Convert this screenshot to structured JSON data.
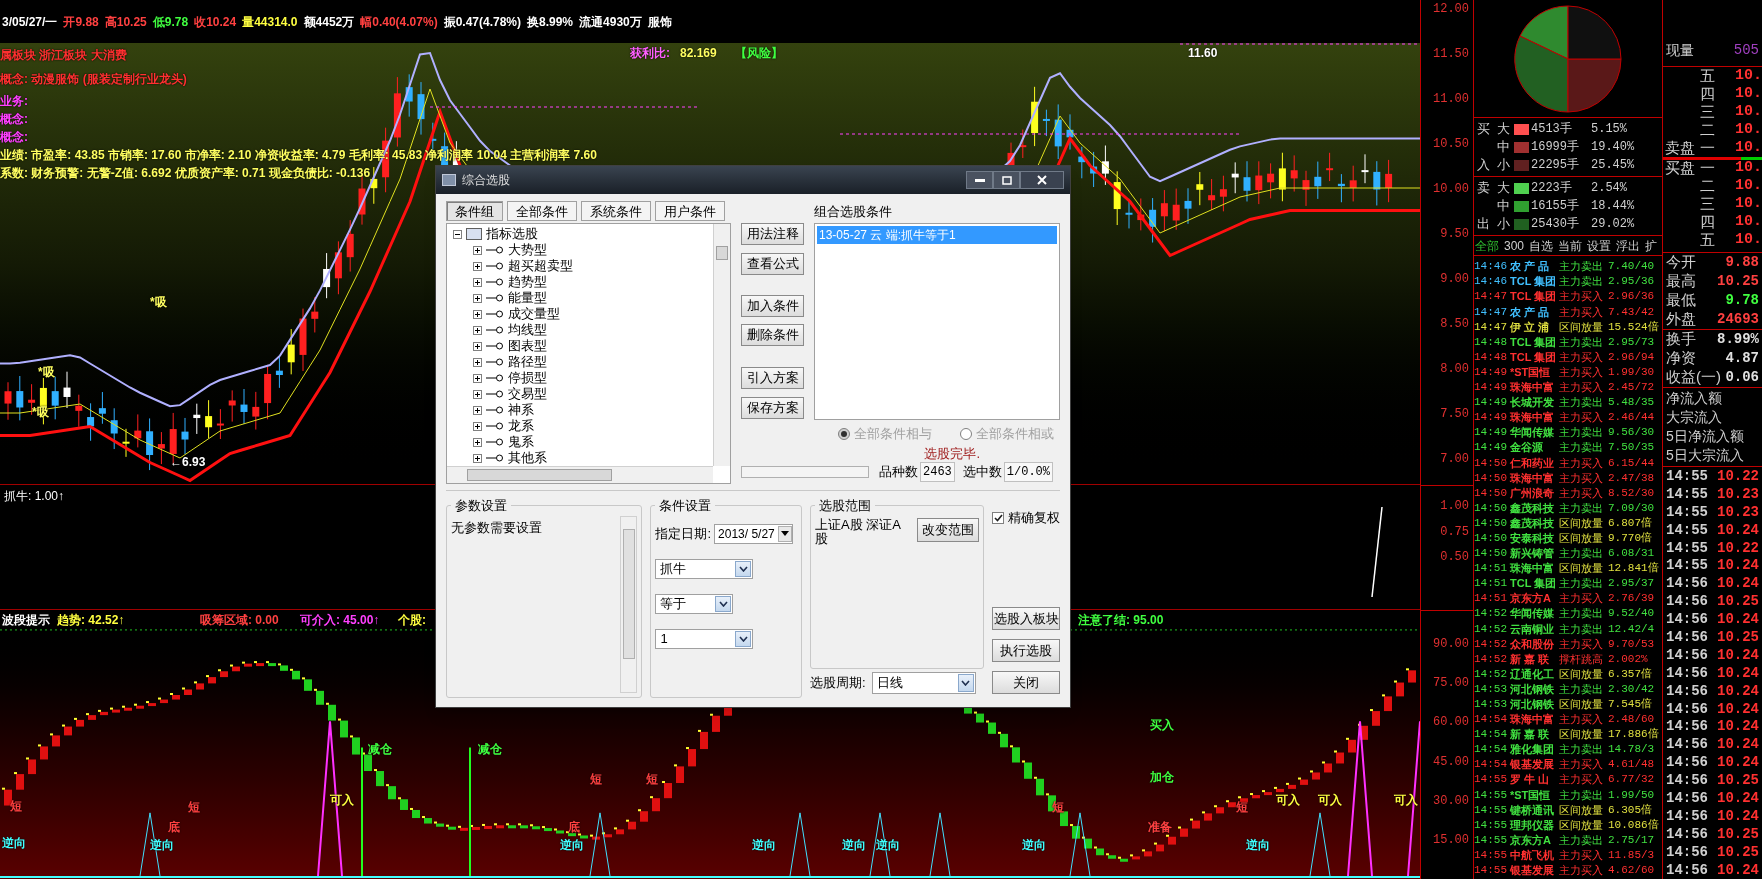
{
  "quote_bar": [
    {
      "text": "3/05/27/一",
      "color": "#ffffff"
    },
    {
      "text": "开9.88",
      "color": "#ff4040"
    },
    {
      "text": "高10.25",
      "color": "#ff4040"
    },
    {
      "text": "低9.78",
      "color": "#40ff40"
    },
    {
      "text": "收10.24",
      "color": "#ff4040"
    },
    {
      "text": "量44314.0",
      "color": "#ffff40"
    },
    {
      "text": "额4452万",
      "color": "#ffffff"
    },
    {
      "text": "幅0.40(4.07%)",
      "color": "#ff4040"
    },
    {
      "text": "振0.47(4.78%)",
      "color": "#ffffff"
    },
    {
      "text": "换8.99%",
      "color": "#ffffff"
    },
    {
      "text": "流通4930万",
      "color": "#ffffff"
    },
    {
      "text": "服饰",
      "color": "#ffffff"
    }
  ],
  "price_chart": {
    "info_lines": [
      {
        "text": "属板块 浙江板块 大消费",
        "color": "#ff3030"
      },
      {
        "text": "概念: 动漫服饰 (服装定制行业龙头)",
        "color": "#ff3030"
      },
      {
        "text": "业务:",
        "color": "#ff40ff"
      },
      {
        "text": "概念:",
        "color": "#ff40ff"
      },
      {
        "text": "概念:",
        "color": "#ff40ff"
      },
      {
        "text": "业绩: 市盈率: 43.85 市销率: 17.60 市净率: 2.10 净资收益率: 4.79 毛利率: 45.83 净利润率 10.04 主营利润率 7.60",
        "color": "#ffff60"
      },
      {
        "text": "系数: 财务预警: 无警-Z值: 6.692 优质资产率: 0.71 现金负债比: -0.136",
        "color": "#ffff60"
      }
    ],
    "labels": [
      {
        "text": "获利比:",
        "color": "#ff60ff"
      },
      {
        "text": "82.169",
        "color": "#ffff60"
      },
      {
        "text": "【风险】",
        "color": "#40ff40"
      },
      {
        "text": "11.60",
        "color": "#ffffff"
      },
      {
        "text": "←6.93",
        "color": "#ffffff"
      },
      {
        "text": "*吸",
        "color": "#ffff60"
      },
      {
        "text": "*吸",
        "color": "#ffff60"
      },
      {
        "text": "*吸",
        "color": "#ffff60"
      }
    ],
    "axis_ticks": [
      "12.00",
      "11.50",
      "11.00",
      "10.50",
      "10.00",
      "9.50",
      "9.00",
      "8.50",
      "8.00",
      "7.50",
      "7.00"
    ]
  },
  "indicator_1": {
    "title": "抓牛: 1.00↑",
    "axis_ticks": [
      "1.00",
      "0.75",
      "0.50"
    ]
  },
  "indicator_2": {
    "header": [
      {
        "text": "波段提示",
        "color": "#ffffff"
      },
      {
        "text": "趋势: 42.52↑",
        "color": "#ffff40"
      },
      {
        "text": "吸筹区域: 0.00",
        "color": "#ff4040"
      },
      {
        "text": "可介入: 45.00↑",
        "color": "#ff40ff"
      },
      {
        "text": "个股:",
        "color": "#ffff40"
      },
      {
        "text": "注意了结: 95.00",
        "color": "#40ff40"
      }
    ],
    "annotations": [
      {
        "text": "短",
        "color": "#ff4040"
      },
      {
        "text": "逆向",
        "color": "#40ffff"
      },
      {
        "text": "底",
        "color": "#ff4040"
      },
      {
        "text": "逆向",
        "color": "#40ffff"
      },
      {
        "text": "短",
        "color": "#ff4040"
      },
      {
        "text": "可入",
        "color": "#ffff40"
      },
      {
        "text": "减仓",
        "color": "#40ff40"
      },
      {
        "text": "减仓",
        "color": "#40ff40"
      },
      {
        "text": "底",
        "color": "#ff4040"
      },
      {
        "text": "短",
        "color": "#ff4040"
      },
      {
        "text": "逆向",
        "color": "#40ffff"
      },
      {
        "text": "短",
        "color": "#ff4040"
      },
      {
        "text": "逆向",
        "color": "#40ffff"
      },
      {
        "text": "逆向",
        "color": "#40ffff"
      },
      {
        "text": "逆向",
        "color": "#40ffff"
      },
      {
        "text": "短",
        "color": "#ff4040"
      },
      {
        "text": "逆向",
        "color": "#40ffff"
      },
      {
        "text": "买入",
        "color": "#40ff40"
      },
      {
        "text": "加仓",
        "color": "#40ff40"
      },
      {
        "text": "准备",
        "color": "#ff4040"
      },
      {
        "text": "短",
        "color": "#ff4040"
      },
      {
        "text": "逆向",
        "color": "#40ffff"
      },
      {
        "text": "可入",
        "color": "#ffff40"
      },
      {
        "text": "可入",
        "color": "#ffff40"
      },
      {
        "text": "可入",
        "color": "#ffff40"
      }
    ],
    "axis_ticks": [
      "90.00",
      "75.00",
      "60.00",
      "45.00",
      "30.00",
      "15.00"
    ]
  },
  "dialog": {
    "title": "综合选股",
    "tabs": [
      {
        "label": "条件组",
        "selected": true
      },
      {
        "label": "全部条件",
        "selected": false
      },
      {
        "label": "系统条件",
        "selected": false
      },
      {
        "label": "用户条件",
        "selected": false
      }
    ],
    "tree": [
      {
        "label": "指标选股",
        "expanded": true,
        "children": [
          {
            "label": "大势型",
            "expanded": false
          },
          {
            "label": "超买超卖型",
            "expanded": false
          },
          {
            "label": "趋势型",
            "expanded": false
          },
          {
            "label": "能量型",
            "expanded": false
          },
          {
            "label": "成交量型",
            "expanded": false
          },
          {
            "label": "均线型",
            "expanded": false
          },
          {
            "label": "图表型",
            "expanded": false
          },
          {
            "label": "路径型",
            "expanded": false
          },
          {
            "label": "停损型",
            "expanded": false
          },
          {
            "label": "交易型",
            "expanded": false
          },
          {
            "label": "神系",
            "expanded": false
          },
          {
            "label": "龙系",
            "expanded": false
          },
          {
            "label": "鬼系",
            "expanded": false
          },
          {
            "label": "其他系",
            "expanded": false
          }
        ]
      }
    ],
    "side_buttons": [
      "用法注释",
      "查看公式",
      "加入条件",
      "删除条件",
      "引入方案",
      "保存方案"
    ],
    "conditions_title": "组合选股条件",
    "conditions": [
      {
        "text": "13-05-27 云 端:抓牛等于1",
        "selected": true
      }
    ],
    "logic": [
      {
        "label": "全部条件相与",
        "selected": true,
        "disabled": true
      },
      {
        "label": "全部条件相或",
        "selected": false,
        "disabled": true
      }
    ],
    "status": "选股完毕.",
    "progress": {
      "level": 0
    },
    "count_label": "品种数",
    "count": "2463",
    "picked_label": "选中数",
    "picked": "1/0.0%",
    "params": {
      "title": "参数设置",
      "text": "无参数需要设置"
    },
    "condition_settings": {
      "title": "条件设置",
      "date_label": "指定日期:",
      "date": "2013/ 5/27",
      "combos": [
        "抓牛",
        "等于",
        "1"
      ]
    },
    "scope": {
      "title": "选股范围",
      "text": "上证A股 深证A股",
      "button": "改变范围"
    },
    "exact_adjust": {
      "label": "精确复权",
      "checked": true
    },
    "action_buttons": [
      "选股入板块",
      "执行选股",
      "关闭"
    ],
    "period_label": "选股周期:",
    "period": "日线"
  },
  "money_flow": [
    {
      "side_top": "买",
      "side_bottom": "入",
      "rows": [
        {
          "size": "大",
          "volume": "4513手",
          "percent": "5.15%",
          "color": "#ff5050"
        },
        {
          "size": "中",
          "volume": "16999手",
          "percent": "19.40%",
          "color": "#a03030"
        },
        {
          "size": "小",
          "volume": "22295手",
          "percent": "25.45%",
          "color": "#602020"
        }
      ]
    },
    {
      "side_top": "卖",
      "side_bottom": "出",
      "rows": [
        {
          "size": "大",
          "volume": "2223手",
          "percent": "2.54%",
          "color": "#50d050"
        },
        {
          "size": "中",
          "volume": "16155手",
          "percent": "18.44%",
          "color": "#30a030"
        },
        {
          "size": "小",
          "volume": "25430手",
          "percent": "29.02%",
          "color": "#206020"
        }
      ]
    }
  ],
  "list_tabs": [
    {
      "label": "全部",
      "selected": true
    },
    {
      "label": "300",
      "selected": false
    },
    {
      "label": "自选",
      "selected": false
    },
    {
      "label": "当前",
      "selected": false
    },
    {
      "label": "设置",
      "selected": false
    },
    {
      "label": "浮出",
      "selected": false
    },
    {
      "label": "扩",
      "selected": false
    }
  ],
  "alerts": [
    {
      "time": "14:46",
      "name": "农 产 品",
      "action": "主力卖出",
      "value": "7.40/40",
      "color": "#40c0ff",
      "kind": "sell"
    },
    {
      "time": "14:46",
      "name": "TCL 集团",
      "action": "主力卖出",
      "value": "2.95/36",
      "color": "#40c0ff",
      "kind": "sell"
    },
    {
      "time": "14:47",
      "name": "TCL 集团",
      "action": "主力买入",
      "value": "2.96/36",
      "color": "#ff3030",
      "kind": "buy"
    },
    {
      "time": "14:47",
      "name": "农 产 品",
      "action": "主力买入",
      "value": "7.43/42",
      "color": "#40c0ff",
      "kind": "buy"
    },
    {
      "time": "14:47",
      "name": "伊 立 浦",
      "action": "区间放量",
      "value": "15.524倍",
      "color": "#e0e040",
      "kind": "volume"
    },
    {
      "time": "14:48",
      "name": "TCL 集团",
      "action": "主力卖出",
      "value": "2.95/73",
      "color": "#40e040",
      "kind": "sell"
    },
    {
      "time": "14:48",
      "name": "TCL 集团",
      "action": "主力买入",
      "value": "2.96/94",
      "color": "#ff3030",
      "kind": "buy"
    },
    {
      "time": "14:49",
      "name": "*ST国恒",
      "action": "主力买入",
      "value": "1.99/30",
      "color": "#ff3030",
      "kind": "buy"
    },
    {
      "time": "14:49",
      "name": "珠海中富",
      "action": "主力买入",
      "value": "2.45/72",
      "color": "#ff3030",
      "kind": "buy"
    },
    {
      "time": "14:49",
      "name": "长城开发",
      "action": "主力卖出",
      "value": "5.48/35",
      "color": "#40e040",
      "kind": "sell"
    },
    {
      "time": "14:49",
      "name": "珠海中富",
      "action": "主力买入",
      "value": "2.46/44",
      "color": "#ff3030",
      "kind": "buy"
    },
    {
      "time": "14:49",
      "name": "华闻传媒",
      "action": "主力卖出",
      "value": "9.56/30",
      "color": "#40e040",
      "kind": "sell"
    },
    {
      "time": "14:49",
      "name": "金谷源",
      "action": "主力卖出",
      "value": "7.50/35",
      "color": "#40e040",
      "kind": "sell"
    },
    {
      "time": "14:50",
      "name": "仁和药业",
      "action": "主力买入",
      "value": "6.15/44",
      "color": "#ff3030",
      "kind": "buy"
    },
    {
      "time": "14:50",
      "name": "珠海中富",
      "action": "主力买入",
      "value": "2.47/38",
      "color": "#ff3030",
      "kind": "buy"
    },
    {
      "time": "14:50",
      "name": "广州浪奇",
      "action": "主力买入",
      "value": "8.52/30",
      "color": "#ff3030",
      "kind": "buy"
    },
    {
      "time": "14:50",
      "name": "鑫茂科技",
      "action": "主力卖出",
      "value": "7.09/30",
      "color": "#40e040",
      "kind": "sell"
    },
    {
      "time": "14:50",
      "name": "鑫茂科技",
      "action": "区间放量",
      "value": "6.807倍",
      "color": "#40e040",
      "kind": "volume"
    },
    {
      "time": "14:50",
      "name": "安泰科技",
      "action": "区间放量",
      "value": "9.770倍",
      "color": "#40e040",
      "kind": "volume"
    },
    {
      "time": "14:50",
      "name": "新兴铸管",
      "action": "主力卖出",
      "value": "6.08/31",
      "color": "#40e040",
      "kind": "sell"
    },
    {
      "time": "14:51",
      "name": "珠海中富",
      "action": "区间放量",
      "value": "12.841倍",
      "color": "#40e040",
      "kind": "volume"
    },
    {
      "time": "14:51",
      "name": "TCL 集团",
      "action": "主力卖出",
      "value": "2.95/37",
      "color": "#40e040",
      "kind": "sell"
    },
    {
      "time": "14:51",
      "name": "京东方A",
      "action": "主力买入",
      "value": "2.76/39",
      "color": "#ff3030",
      "kind": "buy"
    },
    {
      "time": "14:52",
      "name": "华闻传媒",
      "action": "主力卖出",
      "value": "9.52/40",
      "color": "#40e040",
      "kind": "sell"
    },
    {
      "time": "14:52",
      "name": "云南铜业",
      "action": "主力卖出",
      "value": "12.42/4",
      "color": "#40e040",
      "kind": "sell"
    },
    {
      "time": "14:52",
      "name": "众和股份",
      "action": "主力买入",
      "value": "9.70/53",
      "color": "#ff3030",
      "kind": "buy"
    },
    {
      "time": "14:52",
      "name": "新 嘉 联",
      "action": "撑杆跳高",
      "value": "2.002%",
      "color": "#ff3030",
      "kind": "jump"
    },
    {
      "time": "14:52",
      "name": "辽通化工",
      "action": "区间放量",
      "value": "6.357倍",
      "color": "#40e040",
      "kind": "volume"
    },
    {
      "time": "14:53",
      "name": "河北钢铁",
      "action": "主力卖出",
      "value": "2.30/42",
      "color": "#40e040",
      "kind": "sell"
    },
    {
      "time": "14:53",
      "name": "河北钢铁",
      "action": "区间放量",
      "value": "7.545倍",
      "color": "#40e040",
      "kind": "volume"
    },
    {
      "time": "14:54",
      "name": "珠海中富",
      "action": "主力买入",
      "value": "2.48/60",
      "color": "#ff3030",
      "kind": "buy"
    },
    {
      "time": "14:54",
      "name": "新 嘉 联",
      "action": "区间放量",
      "value": "17.886倍",
      "color": "#40e040",
      "kind": "volume"
    },
    {
      "time": "14:54",
      "name": "雅化集团",
      "action": "主力卖出",
      "value": "14.78/3",
      "color": "#40e040",
      "kind": "sell"
    },
    {
      "time": "14:54",
      "name": "银基发展",
      "action": "主力买入",
      "value": "4.61/48",
      "color": "#ff3030",
      "kind": "buy"
    },
    {
      "time": "14:55",
      "name": "罗 牛 山",
      "action": "主力买入",
      "value": "6.77/32",
      "color": "#ff3030",
      "kind": "buy"
    },
    {
      "time": "14:55",
      "name": "*ST国恒",
      "action": "主力卖出",
      "value": "1.99/50",
      "color": "#40e040",
      "kind": "sell"
    },
    {
      "time": "14:55",
      "name": "键桥通讯",
      "action": "区间放量",
      "value": "6.305倍",
      "color": "#40e040",
      "kind": "volume"
    },
    {
      "time": "14:55",
      "name": "理邦仪器",
      "action": "区间放量",
      "value": "10.086倍",
      "color": "#40e040",
      "kind": "volume"
    },
    {
      "time": "14:55",
      "name": "京东方A",
      "action": "主力卖出",
      "value": "2.75/17",
      "color": "#40e040",
      "kind": "sell"
    },
    {
      "time": "14:55",
      "name": "中航飞机",
      "action": "主力买入",
      "value": "11.85/3",
      "color": "#ff3030",
      "kind": "buy"
    },
    {
      "time": "14:55",
      "name": "银基发展",
      "action": "主力买入",
      "value": "4.62/60",
      "color": "#ff3030",
      "kind": "buy"
    }
  ],
  "order_book": {
    "volume_label": "现量",
    "volume": "505",
    "ask_title": "卖盘",
    "bid_title": "买盘",
    "asks": [
      {
        "label": "五",
        "price": "10."
      },
      {
        "label": "四",
        "price": "10."
      },
      {
        "label": "三",
        "price": "10."
      },
      {
        "label": "二",
        "price": "10."
      },
      {
        "label": "一",
        "price": "10."
      }
    ],
    "bids": [
      {
        "label": "一",
        "price": "10."
      },
      {
        "label": "二",
        "price": "10."
      },
      {
        "label": "三",
        "price": "10."
      },
      {
        "label": "四",
        "price": "10."
      },
      {
        "label": "五",
        "price": "10."
      }
    ]
  },
  "stats": [
    {
      "label": "今开",
      "value": "9.88",
      "color": "#ff4040"
    },
    {
      "label": "最高",
      "value": "10.25",
      "color": "#ff4040"
    },
    {
      "label": "最低",
      "value": "9.78",
      "color": "#40ff40"
    },
    {
      "label": "外盘",
      "value": "24693",
      "color": "#ff4040"
    }
  ],
  "stats_2": [
    {
      "label": "换手",
      "value": "8.99%"
    },
    {
      "label": "净资",
      "value": "4.87"
    },
    {
      "label": "收益(一)",
      "value": "0.06"
    }
  ],
  "flow_labels": [
    "净流入额",
    "大宗流入",
    "5日净流入额",
    "5日大宗流入"
  ],
  "trades": [
    {
      "time": "14:55",
      "price": "10.22"
    },
    {
      "time": "14:55",
      "price": "10.23"
    },
    {
      "time": "14:55",
      "price": "10.23"
    },
    {
      "time": "14:55",
      "price": "10.24"
    },
    {
      "time": "14:55",
      "price": "10.22"
    },
    {
      "time": "14:55",
      "price": "10.24"
    },
    {
      "time": "14:56",
      "price": "10.24"
    },
    {
      "time": "14:56",
      "price": "10.25"
    },
    {
      "time": "14:56",
      "price": "10.24"
    },
    {
      "time": "14:56",
      "price": "10.25"
    },
    {
      "time": "14:56",
      "price": "10.24"
    },
    {
      "time": "14:56",
      "price": "10.24"
    },
    {
      "time": "14:56",
      "price": "10.24"
    },
    {
      "time": "14:56",
      "price": "10.24"
    },
    {
      "time": "14:56",
      "price": "10.24"
    },
    {
      "time": "14:56",
      "price": "10.24"
    },
    {
      "time": "14:56",
      "price": "10.24"
    },
    {
      "time": "14:56",
      "price": "10.25"
    },
    {
      "time": "14:56",
      "price": "10.24"
    },
    {
      "time": "14:56",
      "price": "10.24"
    },
    {
      "time": "14:56",
      "price": "10.25"
    },
    {
      "time": "14:56",
      "price": "10.25"
    },
    {
      "time": "14:56",
      "price": "10.24"
    }
  ]
}
